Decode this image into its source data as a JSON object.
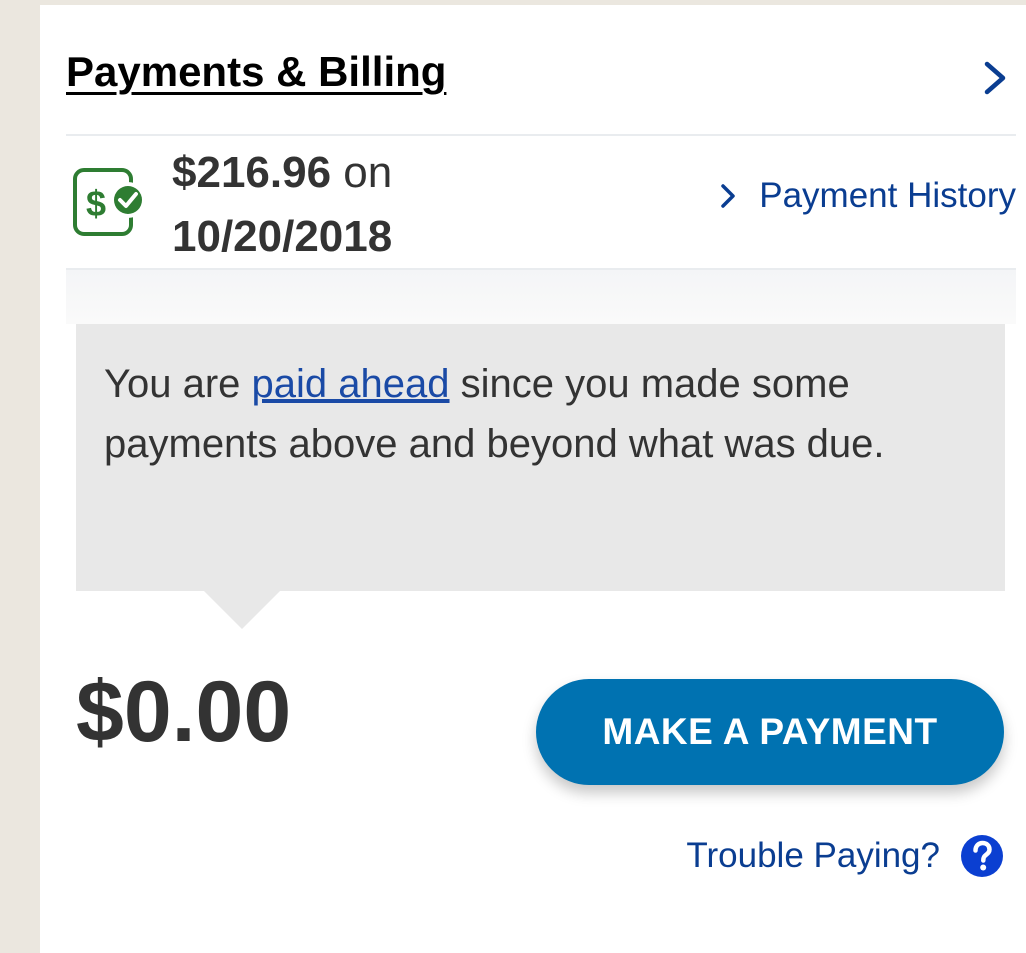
{
  "header": {
    "title": "Payments & Billing"
  },
  "last_payment": {
    "amount": "$216.96",
    "connector": " on",
    "date": "10/20/2018",
    "history_link": "Payment History"
  },
  "notice": {
    "text_before": "You are ",
    "link": "paid ahead",
    "text_after": " since you made some payments above and beyond what was due."
  },
  "balance": {
    "amount": "$0.00"
  },
  "actions": {
    "make_payment": "MAKE A PAYMENT",
    "trouble_paying": "Trouble Paying?"
  },
  "icons": {
    "header_chevron": "chevron-right-icon",
    "payment_status": "dollar-check-icon",
    "history_chevron": "chevron-right-icon",
    "help": "question-circle-icon"
  },
  "colors": {
    "link": "#0a3d91",
    "button": "#0072b1",
    "success": "#2e7d32",
    "callout_bg": "#e8e8e8"
  }
}
